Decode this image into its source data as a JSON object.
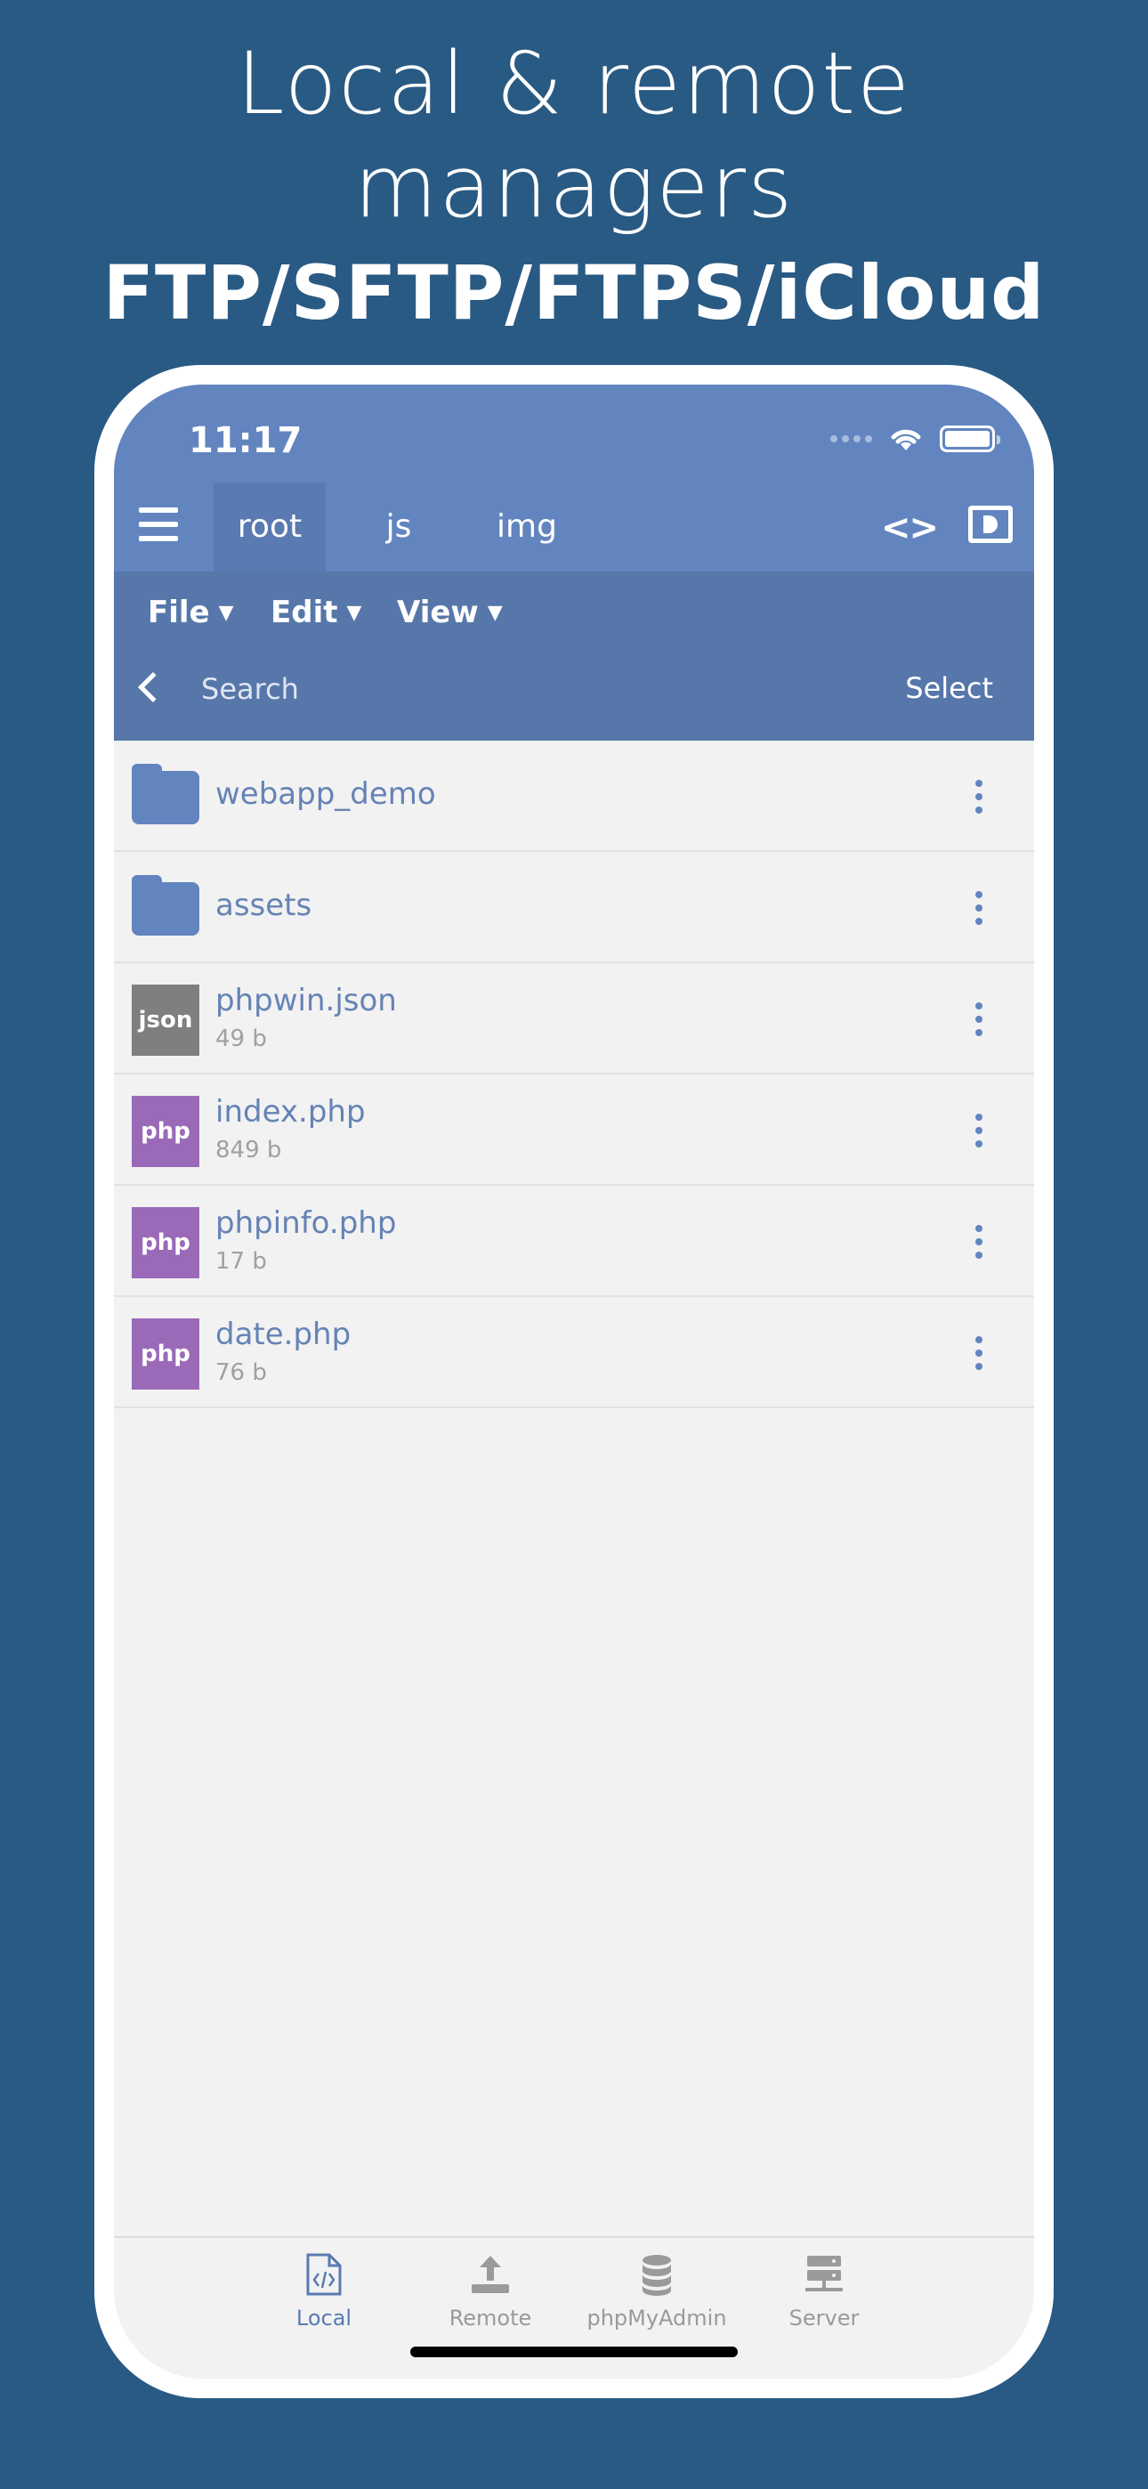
{
  "headline": {
    "line1": "Local & remote",
    "line2": "managers",
    "line3": "FTP/SFTP/FTPS/iCloud"
  },
  "status_bar": {
    "time": "11:17"
  },
  "tabs": [
    {
      "label": "root",
      "active": true
    },
    {
      "label": "js",
      "active": false
    },
    {
      "label": "img",
      "active": false
    }
  ],
  "menu": {
    "file": "File",
    "edit": "Edit",
    "view": "View"
  },
  "search": {
    "placeholder": "Search",
    "select_label": "Select"
  },
  "files": [
    {
      "name": "webapp_demo",
      "type": "folder",
      "icon": "folder-icon"
    },
    {
      "name": "assets",
      "type": "folder",
      "icon": "folder-icon"
    },
    {
      "name": "phpwin.json",
      "size": "49 b",
      "type": "json",
      "badge": "json",
      "badge_color": "#7f7f7f"
    },
    {
      "name": "index.php",
      "size": "849 b",
      "type": "php",
      "badge": "php",
      "badge_color": "#9a6ab8"
    },
    {
      "name": "phpinfo.php",
      "size": "17 b",
      "type": "php",
      "badge": "php",
      "badge_color": "#9a6ab8"
    },
    {
      "name": "date.php",
      "size": "76 b",
      "type": "php",
      "badge": "php",
      "badge_color": "#9a6ab8"
    }
  ],
  "bottom_nav": [
    {
      "label": "Local",
      "icon": "code-file-icon",
      "active": true
    },
    {
      "label": "Remote",
      "icon": "upload-icon",
      "active": false
    },
    {
      "label": "phpMyAdmin",
      "icon": "database-icon",
      "active": false
    },
    {
      "label": "Server",
      "icon": "server-icon",
      "active": false
    }
  ],
  "colors": {
    "background": "#295a84",
    "topbar": "#6285bf",
    "menubar": "#5777aa",
    "accent": "#6285bf"
  }
}
